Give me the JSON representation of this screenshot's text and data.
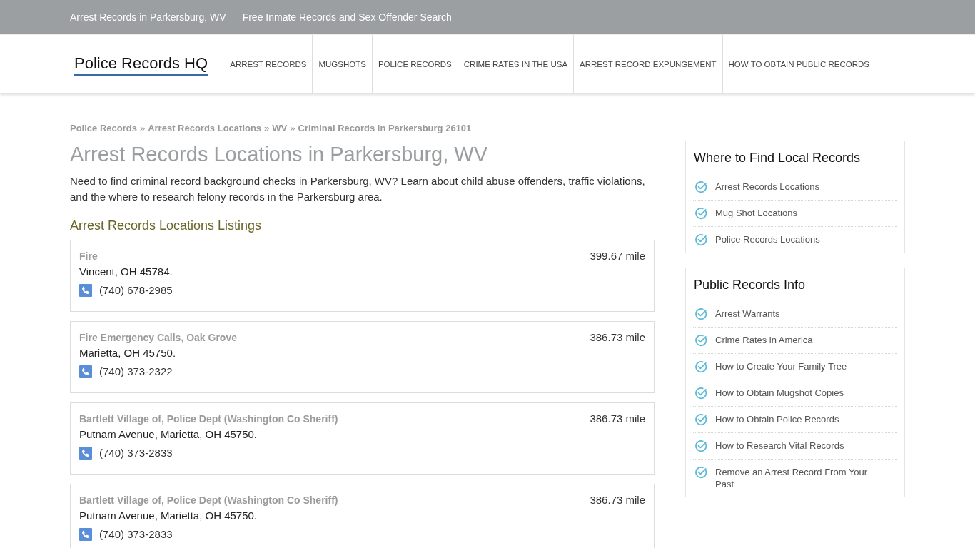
{
  "top_bar": {
    "links": [
      "Arrest Records in Parkersburg, WV",
      "Free Inmate Records and Sex Offender Search"
    ]
  },
  "header": {
    "logo": "Police Records HQ",
    "nav": [
      "ARREST RECORDS",
      "MUGSHOTS",
      "POLICE RECORDS",
      "CRIME RATES IN THE USA",
      "ARREST RECORD EXPUNGEMENT",
      "HOW TO OBTAIN PUBLIC RECORDS"
    ]
  },
  "breadcrumbs": [
    {
      "kind": "link",
      "text": "Police Records"
    },
    {
      "kind": "separator",
      "text": "»"
    },
    {
      "kind": "link",
      "text": "Arrest Records Locations"
    },
    {
      "kind": "separator",
      "text": "»"
    },
    {
      "kind": "link",
      "text": "WV"
    },
    {
      "kind": "separator",
      "text": "»"
    },
    {
      "kind": "link",
      "text": "Criminal Records in Parkersburg 26101"
    }
  ],
  "page_title": "Arrest Records Locations in Parkersburg, WV",
  "intro": "Need to find criminal record background checks in Parkersburg, WV? Learn about child abuse offenders, traffic violations, and the where to research felony records in the Parkersburg area.",
  "listings": {
    "heading": "Arrest Records Locations Listings",
    "items": [
      {
        "name": "Fire",
        "address": "Vincent, OH 45784.",
        "phone": "(740) 678-2985",
        "distance": "399.67 mile"
      },
      {
        "name": "Fire Emergency Calls, Oak Grove",
        "address": "Marietta, OH 45750.",
        "phone": "(740) 373-2322",
        "distance": "386.73 mile"
      },
      {
        "name": "Bartlett Village of, Police Dept (Washington Co Sheriff)",
        "address": "Putnam Avenue, Marietta, OH 45750.",
        "phone": "(740) 373-2833",
        "distance": "386.73 mile"
      },
      {
        "name": "Bartlett Village of, Police Dept (Washington Co Sheriff)",
        "address": "Putnam Avenue, Marietta, OH 45750.",
        "phone": "(740) 373-2833",
        "distance": "386.73 mile"
      }
    ]
  },
  "sidebar": {
    "widgets": [
      {
        "title": "Where to Find Local Records",
        "items": [
          "Arrest Records Locations",
          "Mug Shot Locations",
          "Police Records Locations"
        ]
      },
      {
        "title": "Public Records Info",
        "items": [
          "Arrest Warrants",
          "Crime Rates in America",
          "How to Create Your Family Tree",
          "How to Obtain Mugshot Copies",
          "How to Obtain Police Records",
          "How to Research Vital Records",
          "Remove an Arrest Record From Your Past"
        ]
      }
    ]
  }
}
